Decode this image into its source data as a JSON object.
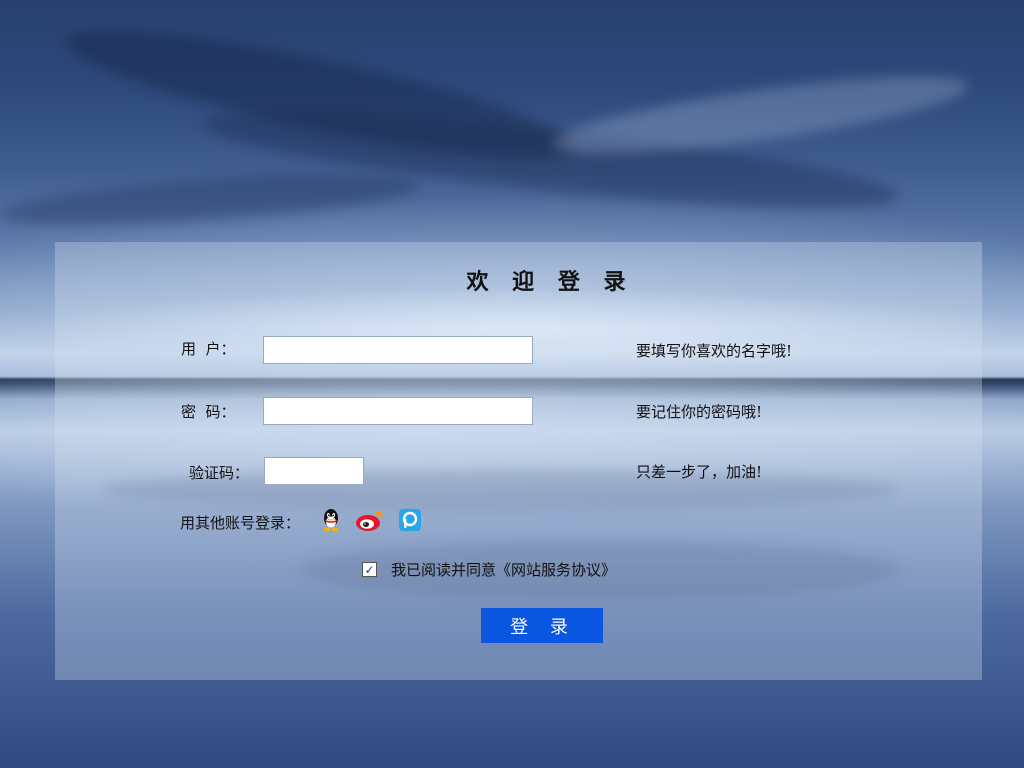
{
  "title": "欢 迎 登 录",
  "form": {
    "username_label": "用  户：",
    "username_value": "",
    "username_hint": "要填写你喜欢的名字哦!",
    "password_label": "密  码：",
    "password_value": "",
    "password_hint": "要记住你的密码哦!",
    "captcha_label": "验证码：",
    "captcha_value": "",
    "captcha_hint": "只差一步了，加油!"
  },
  "social": {
    "label": "用其他账号登录：",
    "icons": [
      "qq-icon",
      "weibo-icon",
      "renren-icon"
    ]
  },
  "agreement": {
    "checked": true,
    "text": "我已阅读并同意",
    "link": "《网站服务协议》"
  },
  "login_button": "登 录",
  "colors": {
    "button": "#0a56e0",
    "panel": "rgba(215,226,243,0.32)"
  }
}
